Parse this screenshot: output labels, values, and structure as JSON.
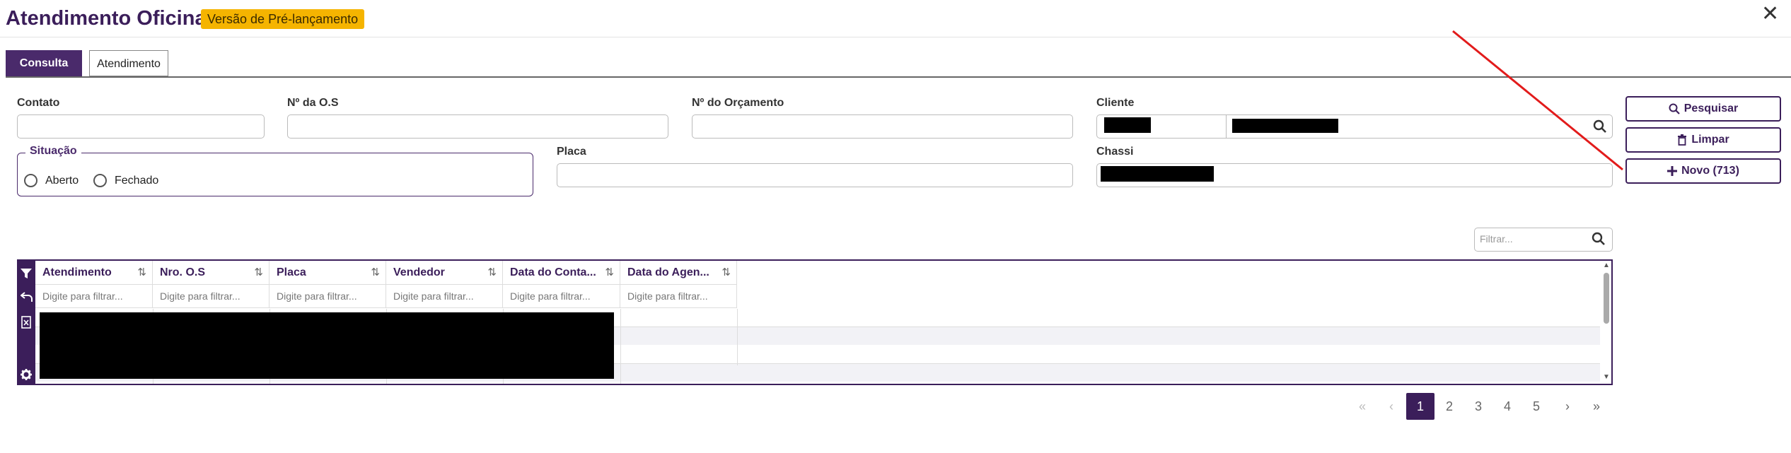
{
  "header": {
    "title": "Atendimento Oficina",
    "badge": "Versão de Pré-lançamento",
    "close_glyph": "✕"
  },
  "tabs": [
    {
      "label": "Consulta",
      "active": true
    },
    {
      "label": "Atendimento",
      "active": false
    }
  ],
  "form": {
    "contato_label": "Contato",
    "os_label": "Nº da O.S",
    "orcamento_label": "Nº do Orçamento",
    "cliente_label": "Cliente",
    "situacao_label": "Situação",
    "aberto_label": "Aberto",
    "fechado_label": "Fechado",
    "placa_label": "Placa",
    "chassi_label": "Chassi"
  },
  "actions": {
    "pesquisar": "Pesquisar",
    "limpar": "Limpar",
    "novo": "Novo (713)"
  },
  "grid": {
    "filter_placeholder": "Filtrar...",
    "columns": [
      "Atendimento",
      "Nro. O.S",
      "Placa",
      "Vendedor",
      "Data do Conta...",
      "Data do Agen..."
    ],
    "column_filter_placeholder": "Digite para filtrar...",
    "sort_glyph": "⇅"
  },
  "pager": {
    "first": "«",
    "prev": "‹",
    "pages": [
      "1",
      "2",
      "3",
      "4",
      "5"
    ],
    "current": "1",
    "next": "›",
    "last": "»"
  },
  "colors": {
    "brand": "#3b1e5a",
    "badge": "#f5b400"
  },
  "icons": [
    "search-icon",
    "trash-icon",
    "plus-icon",
    "filter-icon",
    "undo-icon",
    "excel-icon",
    "gear-icon",
    "close-icon"
  ]
}
